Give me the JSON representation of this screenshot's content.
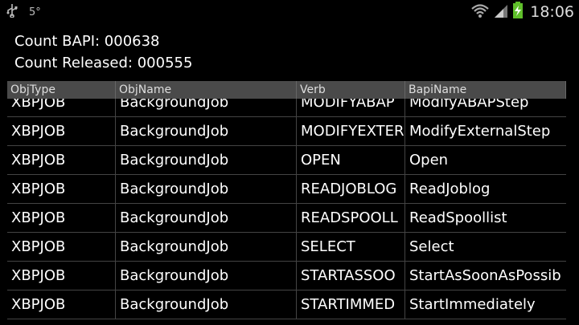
{
  "status_bar": {
    "left_icons": [
      "usb-icon",
      "temperature-icon"
    ],
    "temp_text": "5°",
    "right_icons": [
      "wifi-icon",
      "signal-icon",
      "battery-charging-icon"
    ],
    "time": "18:06"
  },
  "summary": {
    "count_bapi": "Count BAPI: 000638",
    "count_released": "Count Released: 000555"
  },
  "table": {
    "columns": [
      "ObjType",
      "ObjName",
      "Verb",
      "BapiName"
    ],
    "rows": [
      [
        "XBPJOB",
        "BackgroundJob",
        "MODIFYABAP",
        "ModifyABAPStep"
      ],
      [
        "XBPJOB",
        "BackgroundJob",
        "MODIFYEXTER",
        "ModifyExternalStep"
      ],
      [
        "XBPJOB",
        "BackgroundJob",
        "OPEN",
        "Open"
      ],
      [
        "XBPJOB",
        "BackgroundJob",
        "READJOBLOG",
        "ReadJoblog"
      ],
      [
        "XBPJOB",
        "BackgroundJob",
        "READSPOOLL",
        "ReadSpoollist"
      ],
      [
        "XBPJOB",
        "BackgroundJob",
        "SELECT",
        "Select"
      ],
      [
        "XBPJOB",
        "BackgroundJob",
        "STARTASSOO",
        "StartAsSoonAsPossib"
      ],
      [
        "XBPJOB",
        "BackgroundJob",
        "STARTIMMED",
        "StartImmediately"
      ]
    ]
  },
  "colors": {
    "background": "#000000",
    "header_bg": "#4a4a4a",
    "grid_line": "#444444",
    "battery_green": "#5fbf2a"
  }
}
